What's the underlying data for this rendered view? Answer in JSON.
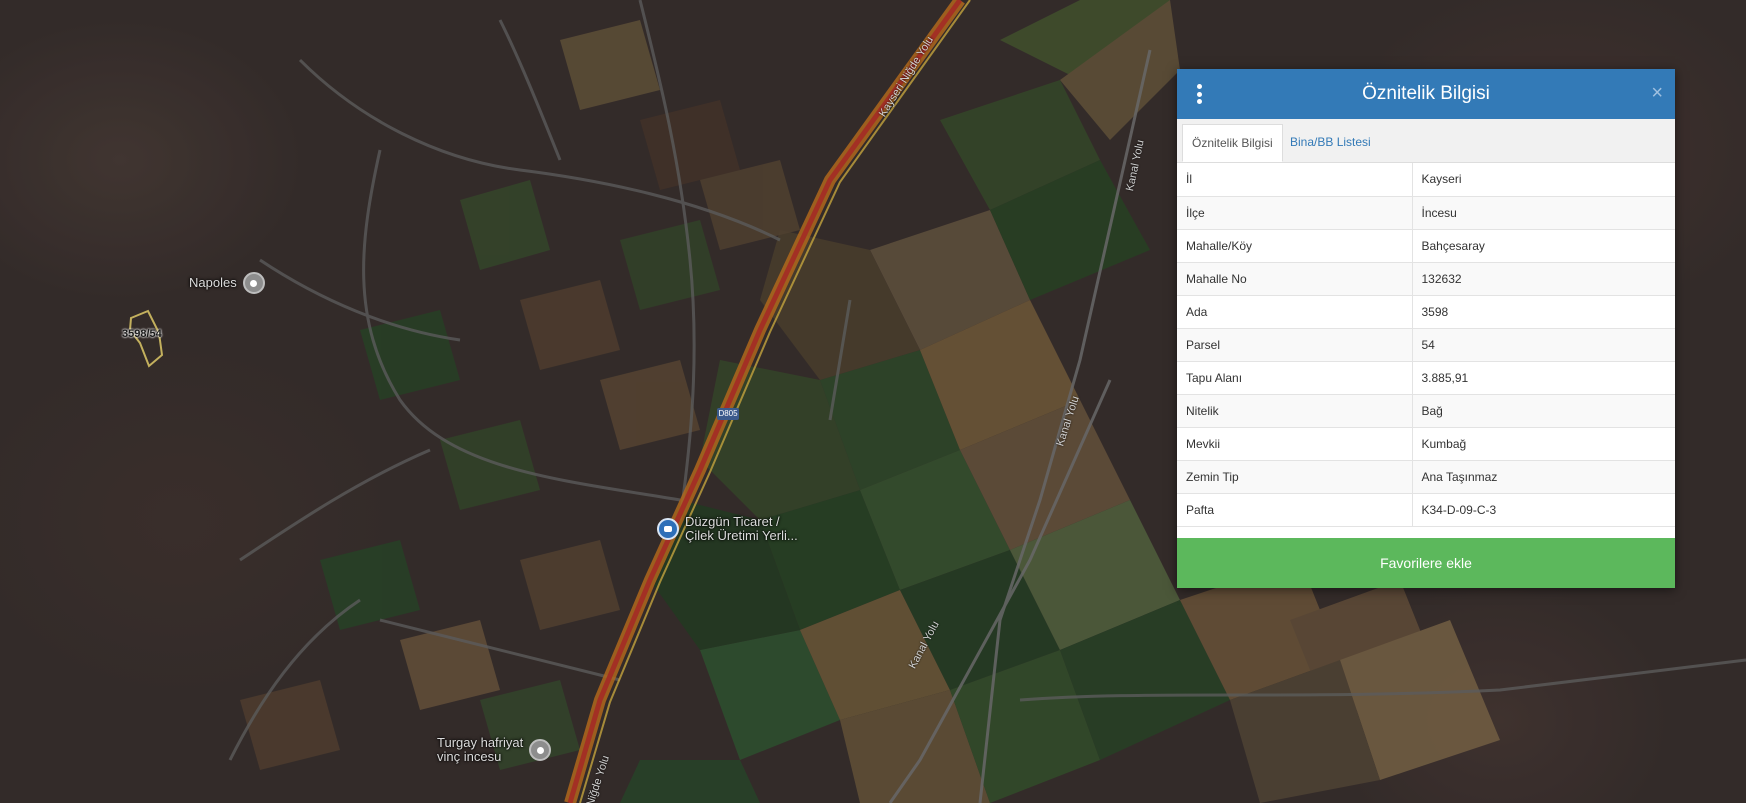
{
  "map": {
    "pois": [
      {
        "label": "Napoles"
      },
      {
        "label": "Düzgün Ticaret /",
        "label2": "Çilek Üretimi Yerli..."
      },
      {
        "label": "Turgay hafriyat",
        "label2": "vinç incesu"
      }
    ],
    "parcel_label": "3598/54",
    "road_labels": [
      "Kayseri Niğde Yolu",
      "Niğde Yolu",
      "Kanal Yolu",
      "Kanal Yolu",
      "Kanal Yolu"
    ],
    "road_shield": "D805"
  },
  "panel": {
    "title": "Öznitelik Bilgisi",
    "close": "×",
    "tabs": [
      {
        "label": "Öznitelik Bilgisi",
        "active": true
      },
      {
        "label": "Bina/BB Listesi",
        "active": false
      }
    ],
    "rows": [
      {
        "key": "İl",
        "value": "Kayseri"
      },
      {
        "key": "İlçe",
        "value": "İncesu"
      },
      {
        "key": "Mahalle/Köy",
        "value": "Bahçesaray"
      },
      {
        "key": "Mahalle No",
        "value": "132632"
      },
      {
        "key": "Ada",
        "value": "3598"
      },
      {
        "key": "Parsel",
        "value": "54"
      },
      {
        "key": "Tapu Alanı",
        "value": "3.885,91"
      },
      {
        "key": "Nitelik",
        "value": "Bağ"
      },
      {
        "key": "Mevkii",
        "value": "Kumbağ"
      },
      {
        "key": "Zemin Tip",
        "value": "Ana Taşınmaz"
      },
      {
        "key": "Pafta",
        "value": "K34-D-09-C-3"
      }
    ],
    "favorite_button": "Favorilere ekle"
  },
  "colors": {
    "header": "#337ab7",
    "button": "#5cb85c",
    "highway": "#c0392b"
  }
}
